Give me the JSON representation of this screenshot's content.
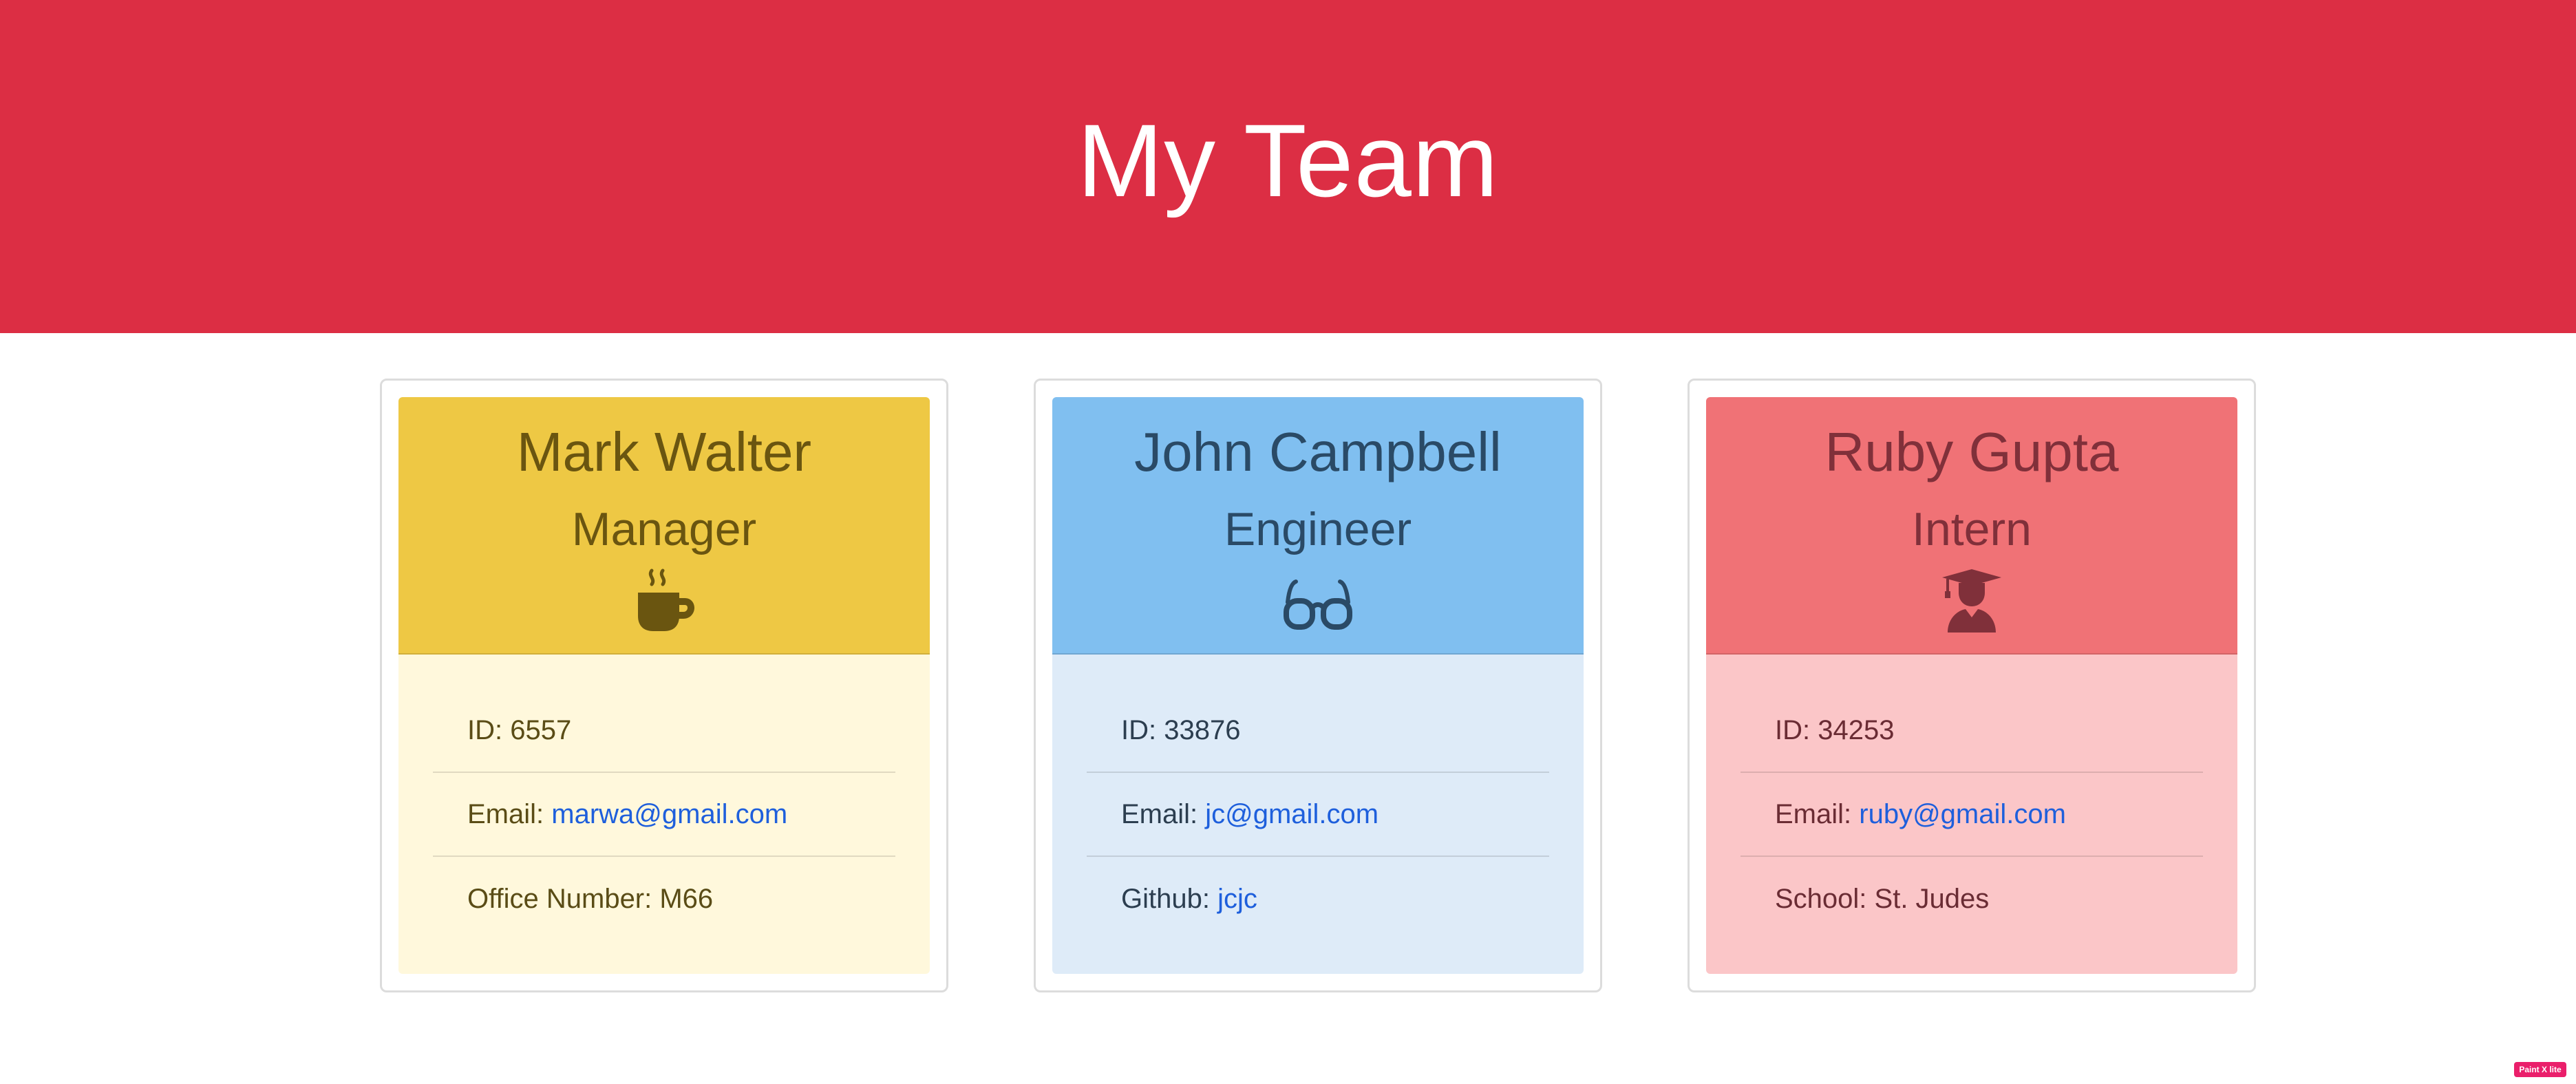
{
  "header": {
    "title": "My Team"
  },
  "team": [
    {
      "name": "Mark Walter",
      "role": "Manager",
      "icon": "coffee-mug-icon",
      "id_label": "ID: ",
      "id": "6557",
      "email_label": "Email: ",
      "email": "marwa@gmail.com",
      "extra_label": "Office Number: ",
      "extra_value": "M66",
      "colors": {
        "header": "#eec844",
        "body": "#fff8dc"
      }
    },
    {
      "name": "John Campbell",
      "role": "Engineer",
      "icon": "glasses-icon",
      "id_label": "ID: ",
      "id": "33876",
      "email_label": "Email: ",
      "email": "jc@gmail.com",
      "extra_label": "Github: ",
      "extra_value": "jcjc",
      "colors": {
        "header": "#80bff0",
        "body": "#deebf8"
      }
    },
    {
      "name": "Ruby Gupta",
      "role": "Intern",
      "icon": "graduate-icon",
      "id_label": "ID: ",
      "id": "34253",
      "email_label": "Email: ",
      "email": "ruby@gmail.com",
      "extra_label": "School: ",
      "extra_value": "St. Judes",
      "colors": {
        "header": "#f07276",
        "body": "#fbc6c8"
      }
    }
  ],
  "badge": {
    "label": "Paint X lite"
  },
  "colors": {
    "header_bg": "#dc2e44",
    "link": "#1e5fdc"
  }
}
